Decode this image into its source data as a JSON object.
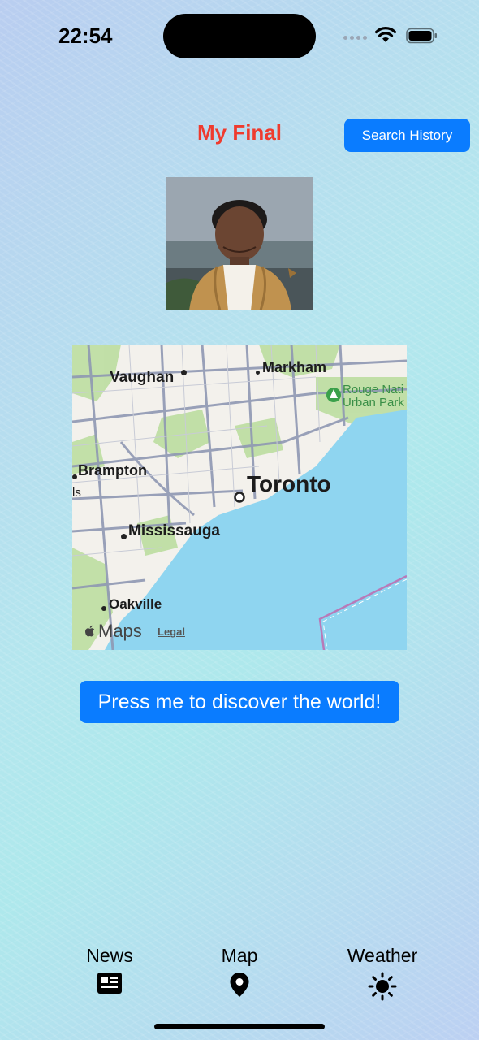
{
  "status_bar": {
    "time": "22:54"
  },
  "header": {
    "title": "My Final",
    "search_history_label": "Search History"
  },
  "map": {
    "labels": {
      "vaughan": "Vaughan",
      "markham": "Markham",
      "rouge": "Rouge Nati",
      "urban_park": "Urban Park",
      "brampton": "Brampton",
      "ls": "ls",
      "toronto": "Toronto",
      "mississauga": "Mississauga",
      "oakville": "Oakville"
    },
    "attribution": "Maps",
    "legal": "Legal"
  },
  "discover_button": {
    "label": "Press me to discover the world!"
  },
  "tabs": [
    {
      "label": "News",
      "icon": "newspaper-icon"
    },
    {
      "label": "Map",
      "icon": "map-pin-icon"
    },
    {
      "label": "Weather",
      "icon": "sun-icon"
    }
  ],
  "colors": {
    "accent": "#0a7cff",
    "title": "#ef3b2e",
    "water": "#8fd5f0",
    "land": "#f3f1ec",
    "park": "#b9dd9c",
    "road": "#8f98b3"
  }
}
